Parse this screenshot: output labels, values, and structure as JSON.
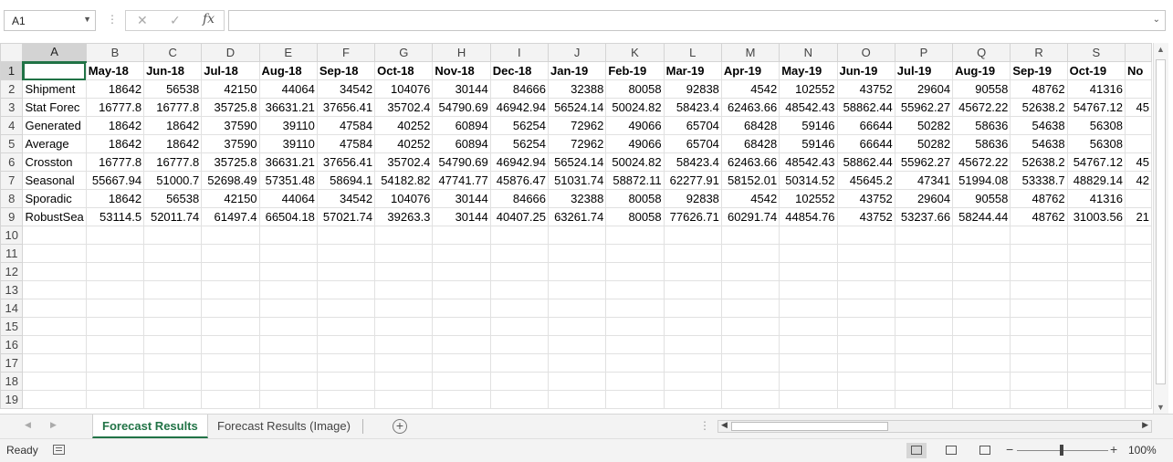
{
  "formula_bar": {
    "name_box": "A1",
    "cancel_glyph": "✕",
    "enter_glyph": "✓",
    "fx_label": "fx",
    "formula": ""
  },
  "columns": [
    "A",
    "B",
    "C",
    "D",
    "E",
    "F",
    "G",
    "H",
    "I",
    "J",
    "K",
    "L",
    "M",
    "N",
    "O",
    "P",
    "Q",
    "R",
    "S",
    ""
  ],
  "rows": [
    {
      "n": "1",
      "cells": [
        "",
        "May-18",
        "Jun-18",
        "Jul-18",
        "Aug-18",
        "Sep-18",
        "Oct-18",
        "Nov-18",
        "Dec-18",
        "Jan-19",
        "Feb-19",
        "Mar-19",
        "Apr-19",
        "May-19",
        "Jun-19",
        "Jul-19",
        "Aug-19",
        "Sep-19",
        "Oct-19",
        "No"
      ]
    },
    {
      "n": "2",
      "cells": [
        "Shipment",
        "18642",
        "56538",
        "42150",
        "44064",
        "34542",
        "104076",
        "30144",
        "84666",
        "32388",
        "80058",
        "92838",
        "4542",
        "102552",
        "43752",
        "29604",
        "90558",
        "48762",
        "41316",
        ""
      ]
    },
    {
      "n": "3",
      "cells": [
        "Stat Forec",
        "16777.8",
        "16777.8",
        "35725.8",
        "36631.21",
        "37656.41",
        "35702.4",
        "54790.69",
        "46942.94",
        "56524.14",
        "50024.82",
        "58423.4",
        "62463.66",
        "48542.43",
        "58862.44",
        "55962.27",
        "45672.22",
        "52638.2",
        "54767.12",
        "45"
      ]
    },
    {
      "n": "4",
      "cells": [
        "Generated",
        "18642",
        "18642",
        "37590",
        "39110",
        "47584",
        "40252",
        "60894",
        "56254",
        "72962",
        "49066",
        "65704",
        "68428",
        "59146",
        "66644",
        "50282",
        "58636",
        "54638",
        "56308",
        ""
      ]
    },
    {
      "n": "5",
      "cells": [
        "Average",
        "18642",
        "18642",
        "37590",
        "39110",
        "47584",
        "40252",
        "60894",
        "56254",
        "72962",
        "49066",
        "65704",
        "68428",
        "59146",
        "66644",
        "50282",
        "58636",
        "54638",
        "56308",
        ""
      ]
    },
    {
      "n": "6",
      "cells": [
        "Crosston",
        "16777.8",
        "16777.8",
        "35725.8",
        "36631.21",
        "37656.41",
        "35702.4",
        "54790.69",
        "46942.94",
        "56524.14",
        "50024.82",
        "58423.4",
        "62463.66",
        "48542.43",
        "58862.44",
        "55962.27",
        "45672.22",
        "52638.2",
        "54767.12",
        "45"
      ]
    },
    {
      "n": "7",
      "cells": [
        "Seasonal",
        "55667.94",
        "51000.7",
        "52698.49",
        "57351.48",
        "58694.1",
        "54182.82",
        "47741.77",
        "45876.47",
        "51031.74",
        "58872.11",
        "62277.91",
        "58152.01",
        "50314.52",
        "45645.2",
        "47341",
        "51994.08",
        "53338.7",
        "48829.14",
        "42"
      ]
    },
    {
      "n": "8",
      "cells": [
        "Sporadic",
        "18642",
        "56538",
        "42150",
        "44064",
        "34542",
        "104076",
        "30144",
        "84666",
        "32388",
        "80058",
        "92838",
        "4542",
        "102552",
        "43752",
        "29604",
        "90558",
        "48762",
        "41316",
        ""
      ]
    },
    {
      "n": "9",
      "cells": [
        "RobustSea",
        "53114.5",
        "52011.74",
        "61497.4",
        "66504.18",
        "57021.74",
        "39263.3",
        "30144",
        "40407.25",
        "63261.74",
        "80058",
        "77626.71",
        "60291.74",
        "44854.76",
        "43752",
        "53237.66",
        "58244.44",
        "48762",
        "31003.56",
        "21"
      ]
    },
    {
      "n": "10",
      "cells": []
    },
    {
      "n": "11",
      "cells": []
    },
    {
      "n": "12",
      "cells": []
    },
    {
      "n": "13",
      "cells": []
    },
    {
      "n": "14",
      "cells": []
    },
    {
      "n": "15",
      "cells": []
    },
    {
      "n": "16",
      "cells": []
    },
    {
      "n": "17",
      "cells": []
    },
    {
      "n": "18",
      "cells": []
    },
    {
      "n": "19",
      "cells": []
    }
  ],
  "sheet_tabs": [
    "Forecast Results",
    "Forecast Results (Image)"
  ],
  "status": {
    "text": "Ready",
    "zoom": "100%"
  },
  "colors": {
    "accent": "#217346",
    "header_bg": "#f3f3f3",
    "gridline": "#e1e1e1"
  }
}
